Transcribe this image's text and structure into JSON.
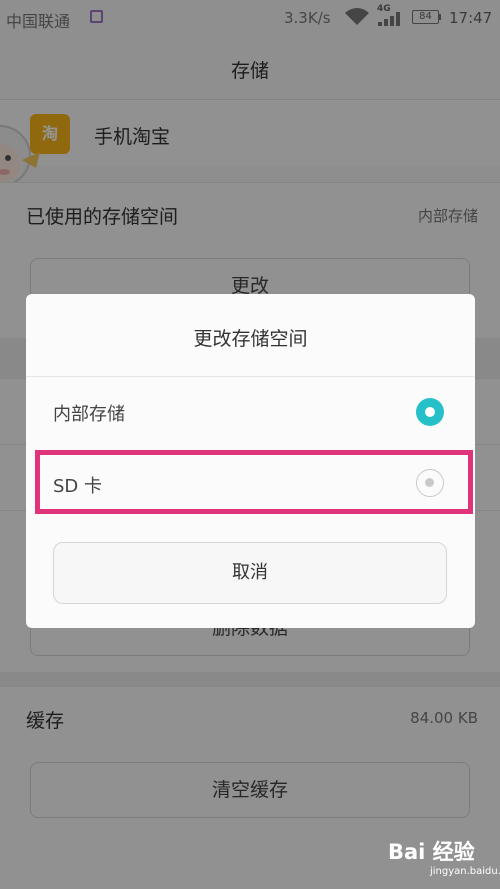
{
  "status_bar": {
    "carrier": "中国联通",
    "speed": "3.3K/s",
    "network": "4G",
    "battery": "84",
    "time": "17:47"
  },
  "header": {
    "title": "存储"
  },
  "app": {
    "name": "手机淘宝",
    "icon_text": "淘"
  },
  "storage_used": {
    "label": "已使用的存储空间",
    "value": "内部存储"
  },
  "change_button": {
    "label": "更改"
  },
  "clear_data_button": {
    "label": "删除数据"
  },
  "cache": {
    "label": "缓存",
    "value": "84.00 KB"
  },
  "clear_cache_button": {
    "label": "清空缓存"
  },
  "dialog": {
    "title": "更改存储空间",
    "options": [
      {
        "label": "内部存储",
        "selected": true
      },
      {
        "label": "SD 卡",
        "selected": false
      }
    ],
    "cancel_label": "取消"
  },
  "watermark": {
    "brand": "Bai 经验",
    "url": "jingyan.baidu.com"
  },
  "colors": {
    "accent": "#25c0c8",
    "highlight": "#e0347a",
    "app_icon": "#f9b51b"
  }
}
